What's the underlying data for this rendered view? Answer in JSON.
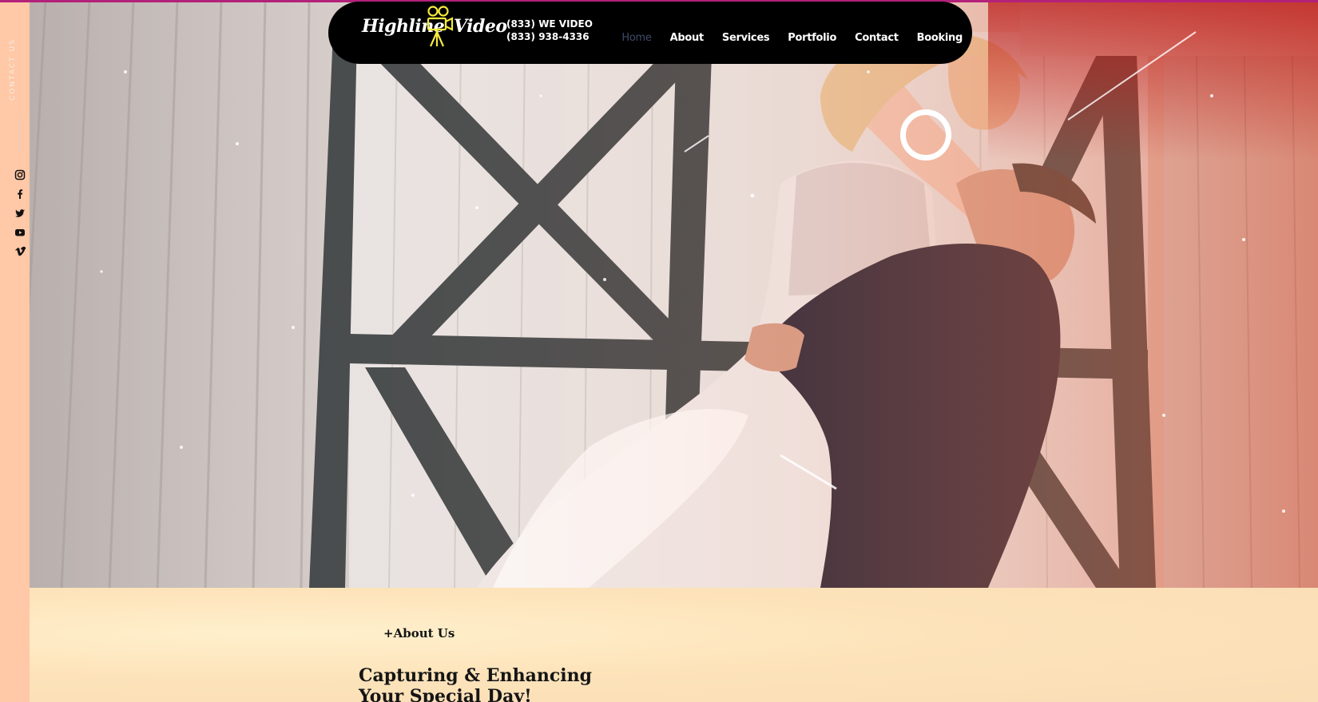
{
  "brand": {
    "logo_left": "Highline",
    "logo_right": "Video",
    "logo_color": "#f5e93b",
    "phone_vanity": "(833) WE VIDEO",
    "phone_number": "(833) 938-4336"
  },
  "nav": {
    "items": [
      "Home",
      "About",
      "Services",
      "Portfolio",
      "Contact",
      "Booking"
    ],
    "active": "Home"
  },
  "sidebar": {
    "contact_label": "CONTACT US",
    "social": [
      "instagram-icon",
      "facebook-icon",
      "twitter-icon",
      "youtube-icon",
      "vimeo-icon"
    ]
  },
  "hero": {
    "media": "video",
    "control_icon": "play-ring-icon"
  },
  "about": {
    "kicker": "+About Us",
    "title": "Capturing & Enhancing Your Special Day!"
  },
  "colors": {
    "accent_top_line": "#b3217a",
    "sidebar_bg": "#ffc8a6",
    "section_bg": "#fde2bb",
    "nav_bg": "#000000",
    "nav_active": "#3f4a6a"
  }
}
